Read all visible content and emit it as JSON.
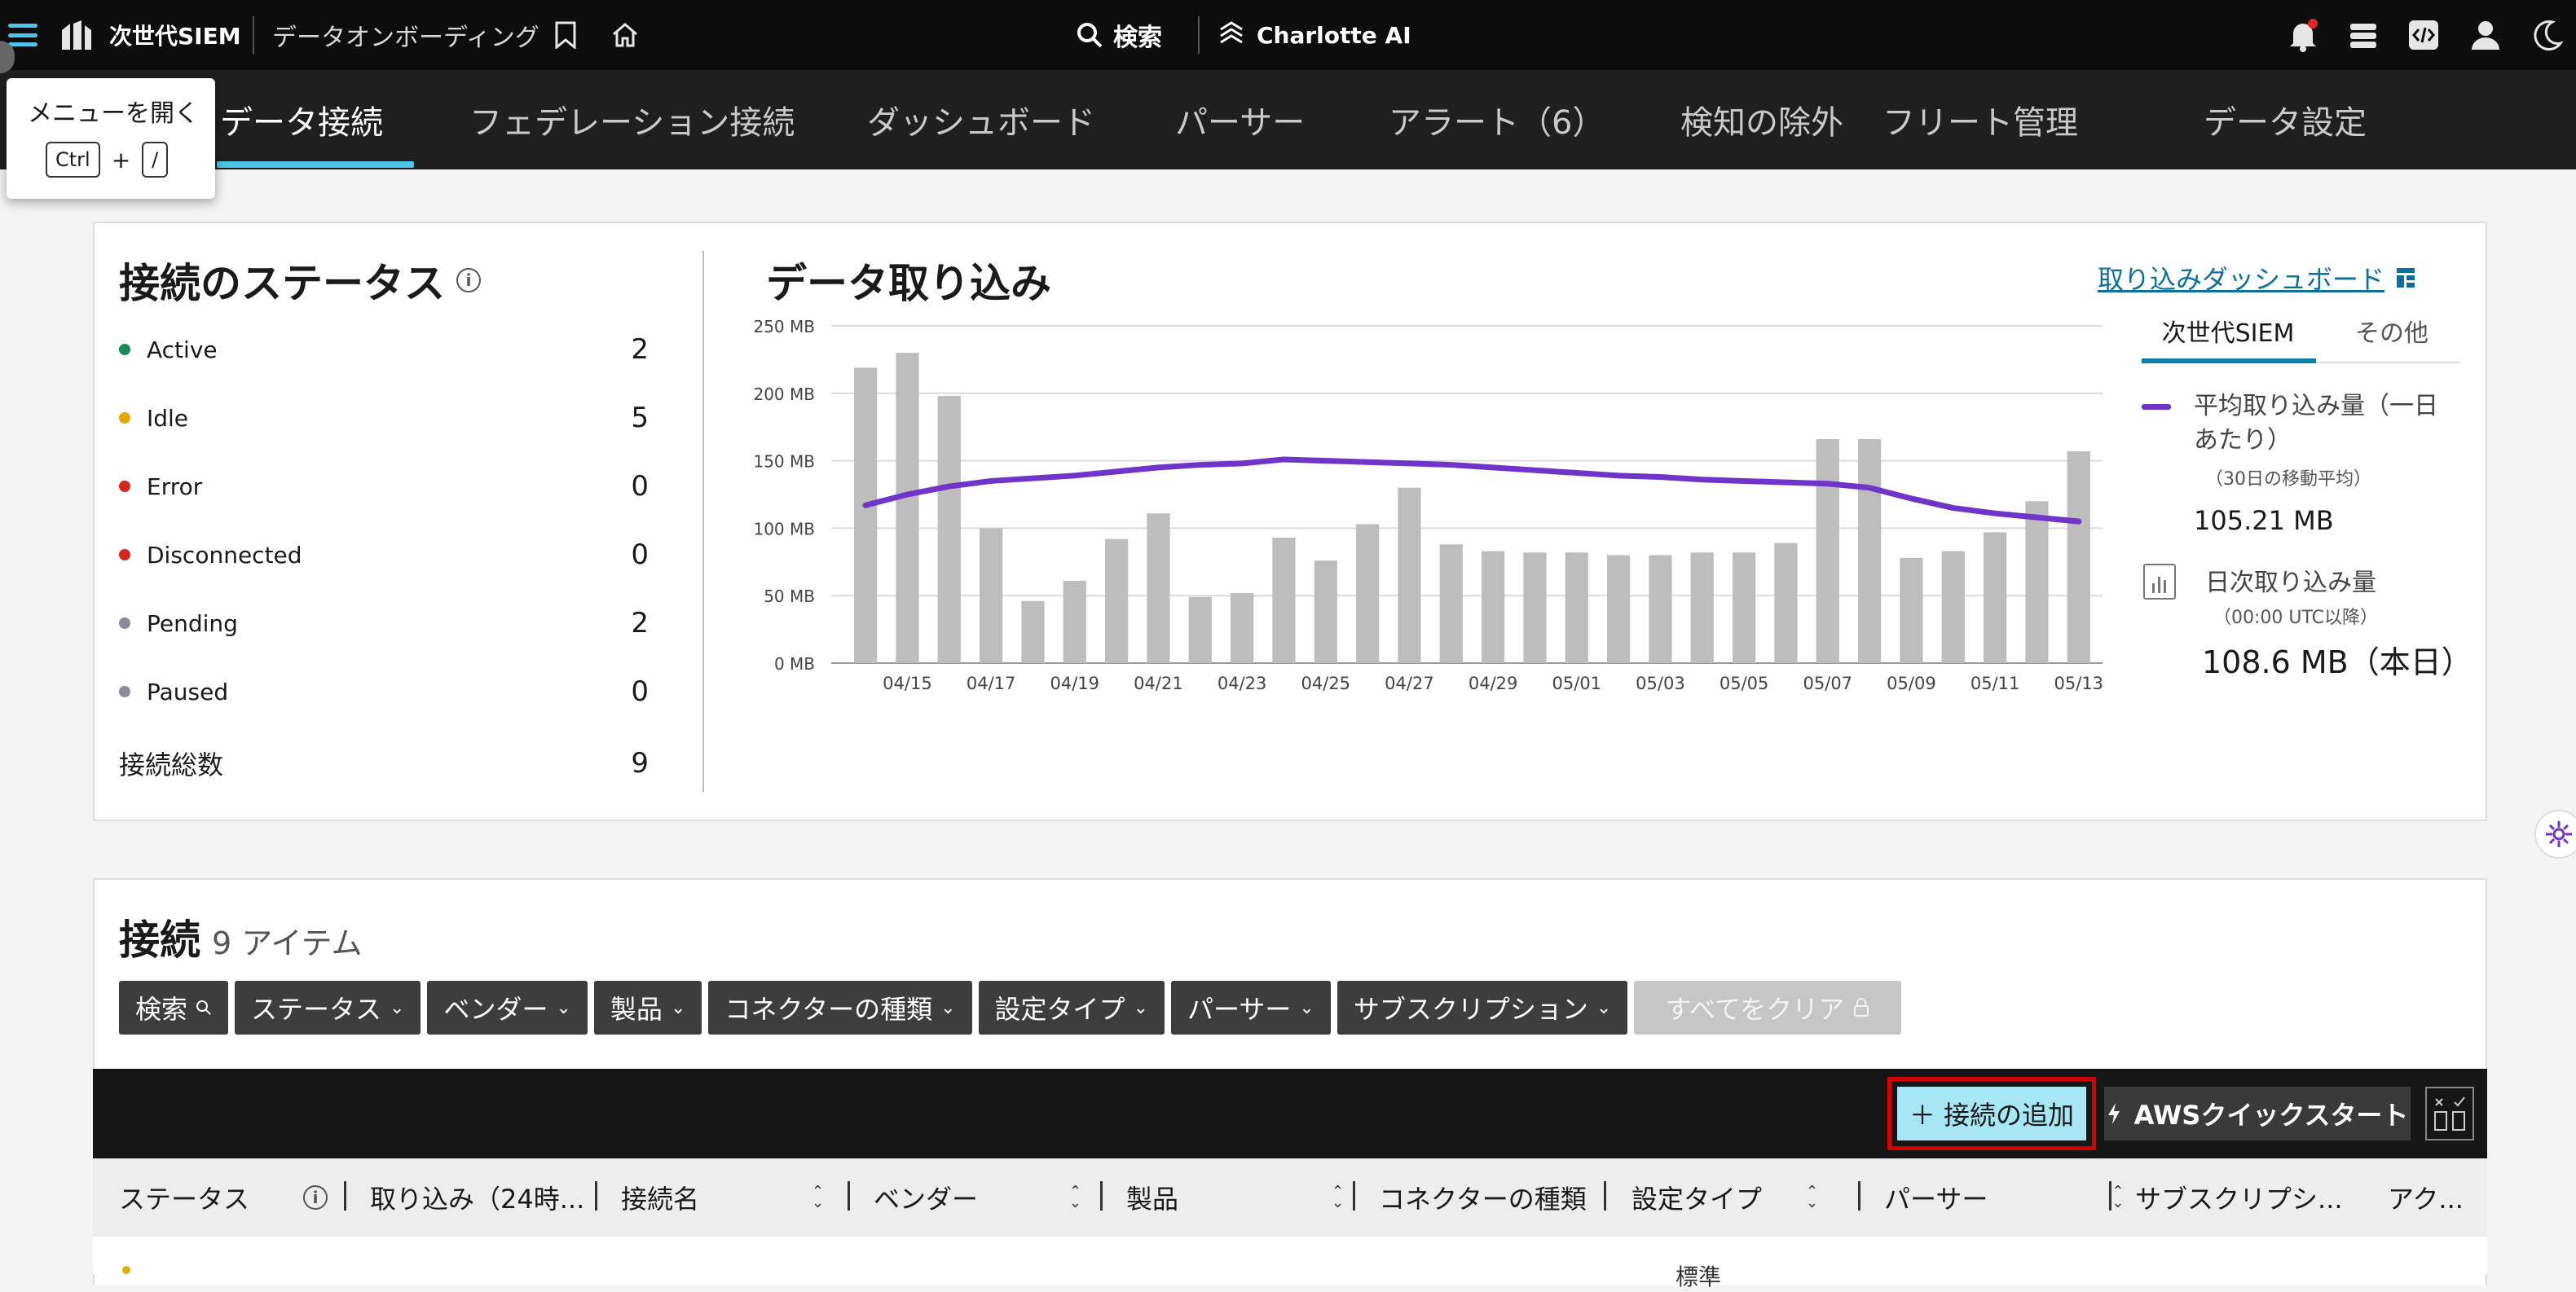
{
  "topbar": {
    "brand": "次世代SIEM",
    "subtitle": "データオンボーディング",
    "search_label": "検索",
    "charlotte_label": "Charlotte AI"
  },
  "tooltip": {
    "title": "メニューを開く",
    "key1": "Ctrl",
    "plus": "+",
    "key2": "/"
  },
  "tabs": [
    {
      "label": "データ接続",
      "active": true
    },
    {
      "label": "フェデレーション接続"
    },
    {
      "label": "ダッシュボード"
    },
    {
      "label": "パーサー"
    },
    {
      "label": "アラート（6）"
    },
    {
      "label": "検知の除外"
    },
    {
      "label": "フリート管理"
    },
    {
      "label": "データ設定"
    }
  ],
  "status_panel": {
    "title": "接続のステータス",
    "rows": [
      {
        "label": "Active",
        "count": "2",
        "color": "#1a8a5a"
      },
      {
        "label": "Idle",
        "count": "5",
        "color": "#e5a800"
      },
      {
        "label": "Error",
        "count": "0",
        "color": "#d9261c"
      },
      {
        "label": "Disconnected",
        "count": "0",
        "color": "#d9261c"
      },
      {
        "label": "Pending",
        "count": "2",
        "color": "#8a8a9a"
      },
      {
        "label": "Paused",
        "count": "0",
        "color": "#8a8a9a"
      }
    ],
    "total_label": "接続総数",
    "total_count": "9"
  },
  "ingest_panel": {
    "title": "データ取り込み",
    "dashboard_link": "取り込みダッシュボード",
    "tabs": [
      "次世代SIEM",
      "その他"
    ],
    "avg_label": "平均取り込み量（一日あたり）",
    "avg_note": "（30日の移動平均）",
    "avg_value": "105.21 MB",
    "daily_label": "日次取り込み量",
    "daily_note": "（00:00 UTC以降）",
    "daily_value": "108.6 MB（本日）"
  },
  "chart_data": {
    "type": "bar",
    "ylim": [
      0,
      250
    ],
    "yticks": [
      "0 MB",
      "50 MB",
      "100 MB",
      "150 MB",
      "200 MB",
      "250 MB"
    ],
    "grid": true,
    "categories": [
      "04/14",
      "04/15",
      "04/16",
      "04/17",
      "04/18",
      "04/19",
      "04/20",
      "04/21",
      "04/22",
      "04/23",
      "04/24",
      "04/25",
      "04/26",
      "04/27",
      "04/28",
      "04/29",
      "04/30",
      "05/01",
      "05/02",
      "05/03",
      "05/04",
      "05/05",
      "05/06",
      "05/07",
      "05/08",
      "05/09",
      "05/10",
      "05/11",
      "05/12",
      "05/13"
    ],
    "xtick_labels": [
      "04/15",
      "04/17",
      "04/19",
      "04/21",
      "04/23",
      "04/25",
      "04/27",
      "04/29",
      "05/01",
      "05/03",
      "05/05",
      "05/07",
      "05/09",
      "05/11",
      "05/13"
    ],
    "series": [
      {
        "name": "日次取り込み量",
        "type": "bar",
        "color": "#bdbdbd",
        "values": [
          219,
          230,
          198,
          100,
          46,
          61,
          92,
          111,
          49,
          52,
          93,
          76,
          103,
          130,
          88,
          83,
          82,
          82,
          80,
          80,
          82,
          82,
          89,
          166,
          166,
          78,
          83,
          97,
          120,
          157
        ]
      },
      {
        "name": "平均取り込み量（一日あたり）",
        "type": "line",
        "color": "#7134c9",
        "values": [
          117,
          125,
          131,
          135,
          137,
          139,
          142,
          145,
          147,
          148,
          151,
          150,
          149,
          148,
          147,
          145,
          143,
          141,
          139,
          138,
          136,
          135,
          134,
          133,
          130,
          122,
          115,
          111,
          108,
          105
        ]
      }
    ]
  },
  "connections": {
    "title": "接続",
    "count_label": "9 アイテム",
    "filters": [
      "検索",
      "ステータス",
      "ベンダー",
      "製品",
      "コネクターの種類",
      "設定タイプ",
      "パーサー",
      "サブスクリプション"
    ],
    "clear_all": "すべてをクリア",
    "add_button": "接続の追加",
    "aws_button": "AWSクイックスタート",
    "columns": [
      "ステータス",
      "取り込み（24時...",
      "接続名",
      "ベンダー",
      "製品",
      "コネクターの種類",
      "設定タイプ",
      "パーサー",
      "サブスクリプシ...",
      "アク..."
    ],
    "row_peek": "標準"
  }
}
